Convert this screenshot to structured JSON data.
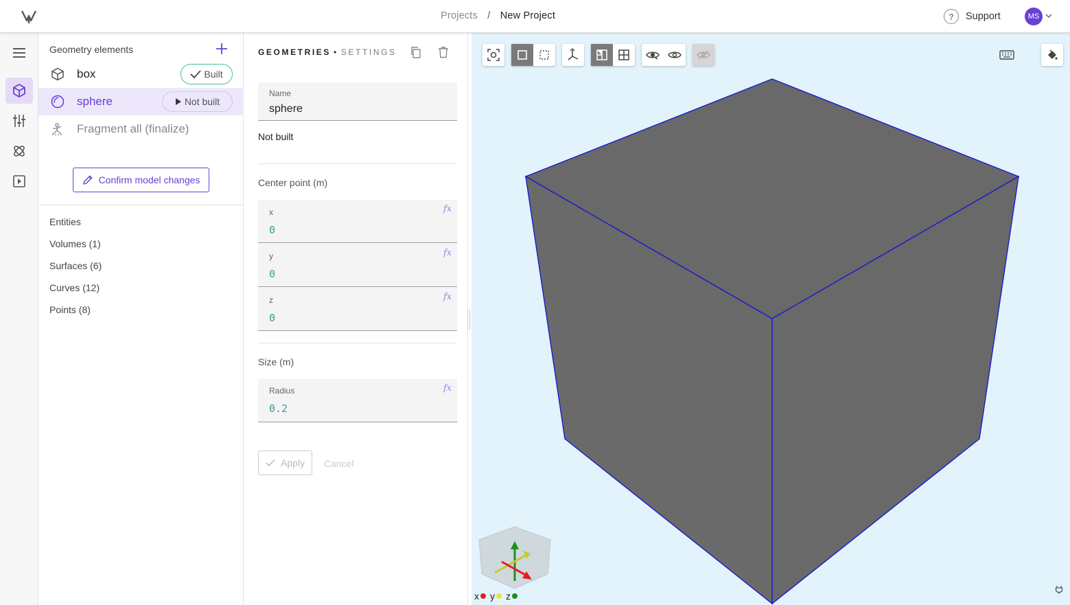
{
  "header": {
    "breadcrumb_root": "Projects",
    "breadcrumb_separator": "/",
    "breadcrumb_current": "New Project",
    "support_label": "Support",
    "user_initials": "MS"
  },
  "geometry": {
    "heading": "Geometry elements",
    "items": [
      {
        "label": "box",
        "status": "Built"
      },
      {
        "label": "sphere",
        "status": "Not built"
      },
      {
        "label": "Fragment all (finalize)",
        "status": ""
      }
    ],
    "confirm_label": "Confirm model changes",
    "entities_heading": "Entities",
    "entities": [
      "Volumes (1)",
      "Surfaces (6)",
      "Curves (12)",
      "Points (8)"
    ]
  },
  "settings": {
    "tab_active": "Geometries",
    "tab_separator": "•",
    "tab_inactive": "Settings",
    "name_label": "Name",
    "name_value": "sphere",
    "status_text": "Not built",
    "center_label": "Center point (m)",
    "x_label": "x",
    "x_value": "0",
    "y_label": "y",
    "y_value": "0",
    "z_label": "z",
    "z_value": "0",
    "size_label": "Size (m)",
    "radius_label": "Radius",
    "radius_value": "0.2",
    "fx_symbol": "fx",
    "apply_label": "Apply",
    "cancel_label": "Cancel"
  },
  "viewport": {
    "axis_x": "x",
    "axis_y": "y",
    "axis_z": "z",
    "colors": {
      "background": "#e2f3fc",
      "face": "#696969",
      "edge": "#1a1ad0",
      "accent": "#6a3fd6",
      "x_axis": "#e02020",
      "y_axis": "#e6e640",
      "z_axis": "#1f8f1f"
    }
  }
}
